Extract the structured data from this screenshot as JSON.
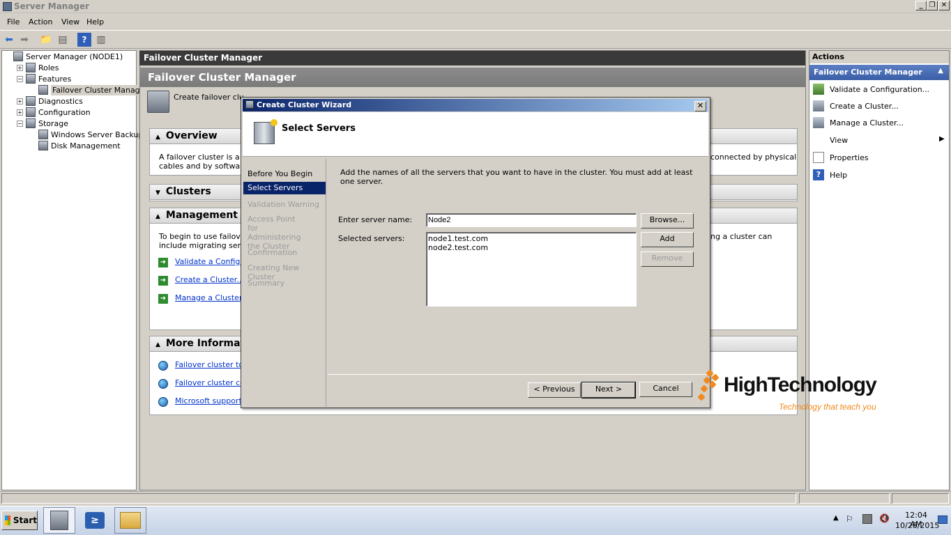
{
  "window": {
    "title": "Server Manager"
  },
  "menu": [
    "File",
    "Action",
    "View",
    "Help"
  ],
  "tree": [
    {
      "label": "Server Manager (NODE1)",
      "indent": 0,
      "expander": ""
    },
    {
      "label": "Roles",
      "indent": 1,
      "expander": "+"
    },
    {
      "label": "Features",
      "indent": 1,
      "expander": "−"
    },
    {
      "label": "Failover Cluster Manager",
      "indent": 2,
      "expander": "",
      "selected": true
    },
    {
      "label": "Diagnostics",
      "indent": 1,
      "expander": "+"
    },
    {
      "label": "Configuration",
      "indent": 1,
      "expander": "+"
    },
    {
      "label": "Storage",
      "indent": 1,
      "expander": "−"
    },
    {
      "label": "Windows Server Backup",
      "indent": 2,
      "expander": ""
    },
    {
      "label": "Disk Management",
      "indent": 2,
      "expander": ""
    }
  ],
  "center": {
    "header_dark": "Failover Cluster Manager",
    "header_grey": "Failover Cluster Manager",
    "intro": "Create failover clusters, validate hardware for potential failover clusters, and perform configuration changes to your failover clusters.",
    "overview": {
      "title": "Overview",
      "text_left": "A failover cluster is a set",
      "text_left2": "cables and by software.",
      "text_right": "connected by physical"
    },
    "clusters": {
      "title": "Clusters"
    },
    "management": {
      "title": "Management",
      "text_left": "To begin to use failover c",
      "text_left2": "include migrating service",
      "text_right": "ng a cluster can",
      "links": [
        "Validate a Configura",
        "Create a Cluster...",
        "Manage a Cluster..."
      ]
    },
    "more_info": {
      "title": "More Informatio",
      "links": [
        "Failover cluster topic",
        "Failover cluster com",
        "Microsoft support pa"
      ]
    }
  },
  "actions": {
    "title": "Actions",
    "subtitle": "Failover Cluster Manager",
    "items": [
      "Validate a Configuration...",
      "Create a Cluster...",
      "Manage a Cluster...",
      "View",
      "Properties",
      "Help"
    ]
  },
  "dialog": {
    "title": "Create Cluster Wizard",
    "heading": "Select Servers",
    "nav": [
      "Before You Begin",
      "Select Servers",
      "Validation Warning",
      "Access Point for Administering the Cluster",
      "Confirmation",
      "Creating New Cluster",
      "Summary"
    ],
    "instruction": "Add the names of all the servers that you want to have in the cluster. You must add at least one server.",
    "server_name_label": "Enter server name:",
    "server_name_value": "Node2",
    "selected_label": "Selected servers:",
    "selected_servers": [
      "node1.test.com",
      "node2.test.com"
    ],
    "browse": "Browse...",
    "add": "Add",
    "remove": "Remove",
    "previous": "< Previous",
    "next": "Next >",
    "cancel": "Cancel"
  },
  "watermark": {
    "brand": "HighTechnology",
    "tagline": "Technology that teach you"
  },
  "taskbar": {
    "start": "Start",
    "time": "12:04 AM",
    "date": "10/28/2015"
  },
  "colors": {
    "accent": "#0a246a",
    "brand_orange": "#f08a1e"
  }
}
